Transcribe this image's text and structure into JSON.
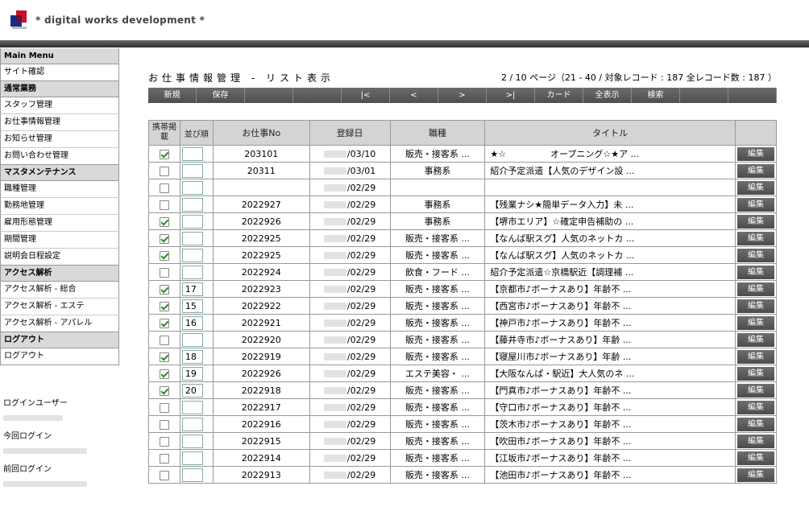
{
  "header": {
    "brand": "* digital works development *"
  },
  "sidebar": {
    "sections": [
      {
        "head": "Main Menu",
        "items": [
          "サイト確認"
        ]
      },
      {
        "head": "通常業務",
        "items": [
          "スタッフ管理",
          "お仕事情報管理",
          "お知らせ管理",
          "お問い合わせ管理"
        ]
      },
      {
        "head": "マスタメンテナンス",
        "items": [
          "職種管理",
          "勤務地管理",
          "雇用形態管理",
          "期間管理",
          "説明会日程設定"
        ]
      },
      {
        "head": "アクセス解析",
        "items": [
          "アクセス解析 - 総合",
          "アクセス解析 - エステ",
          "アクセス解析 - アパレル"
        ]
      },
      {
        "head": "ログアウト",
        "items": [
          "ログアウト"
        ]
      }
    ],
    "login_user_label": "ログインユーザー",
    "this_login_label": "今回ログイン",
    "last_login_label": "前回ログイン"
  },
  "main": {
    "title": "お仕事情報管理 - リスト表示",
    "page_info": "2 / 10 ページ（21 - 40 / 対象レコード : 187 全レコード数 : 187 ）",
    "toolbar": [
      "新規",
      "保存",
      "",
      "",
      "|<",
      "<",
      ">",
      ">|",
      "カード",
      "全表示",
      "検索",
      "",
      ""
    ],
    "columns": [
      "携帯掲載",
      "並び順",
      "お仕事No",
      "登録日",
      "職種",
      "タイトル",
      ""
    ],
    "edit_label": "編集",
    "rows": [
      {
        "checked": true,
        "order": "",
        "no": "203101",
        "date": "/03/10",
        "job": "販売・接客系 ...",
        "title": "★☆　　　　　オープニング☆★ア ..."
      },
      {
        "checked": false,
        "order": "",
        "no": "20311",
        "date": "/03/01",
        "job": "事務系",
        "title": "紹介予定派遣【人気のデザイン設 ..."
      },
      {
        "checked": false,
        "order": "",
        "no": "",
        "date": "/02/29",
        "job": "",
        "title": ""
      },
      {
        "checked": false,
        "order": "",
        "no": "2022927",
        "date": "/02/29",
        "job": "事務系",
        "title": "【残業ナシ★簡単データ入力】未 ..."
      },
      {
        "checked": true,
        "order": "",
        "no": "2022926",
        "date": "/02/29",
        "job": "事務系",
        "title": "【堺市エリア】☆確定申告補助の ..."
      },
      {
        "checked": true,
        "order": "",
        "no": "2022925",
        "date": "/02/29",
        "job": "販売・接客系 ...",
        "title": "【なんば駅スグ】人気のネットカ ..."
      },
      {
        "checked": true,
        "order": "",
        "no": "2022925",
        "date": "/02/29",
        "job": "販売・接客系 ...",
        "title": "【なんば駅スグ】人気のネットカ ..."
      },
      {
        "checked": false,
        "order": "",
        "no": "2022924",
        "date": "/02/29",
        "job": "飲食・フード ...",
        "title": "紹介予定派遣☆京橋駅近【調理補 ..."
      },
      {
        "checked": true,
        "order": "17",
        "no": "2022923",
        "date": "/02/29",
        "job": "販売・接客系 ...",
        "title": "【京都市♪ボーナスあり】年齢不 ..."
      },
      {
        "checked": true,
        "order": "15",
        "no": "2022922",
        "date": "/02/29",
        "job": "販売・接客系 ...",
        "title": "【西宮市♪ボーナスあり】年齢不 ..."
      },
      {
        "checked": true,
        "order": "16",
        "no": "2022921",
        "date": "/02/29",
        "job": "販売・接客系 ...",
        "title": "【神戸市♪ボーナスあり】年齢不 ..."
      },
      {
        "checked": false,
        "order": "",
        "no": "2022920",
        "date": "/02/29",
        "job": "販売・接客系 ...",
        "title": "【藤井寺市♪ボーナスあり】年齢 ..."
      },
      {
        "checked": true,
        "order": "18",
        "no": "2022919",
        "date": "/02/29",
        "job": "販売・接客系 ...",
        "title": "【寝屋川市♪ボーナスあり】年齢 ..."
      },
      {
        "checked": true,
        "order": "19",
        "no": "2022926",
        "date": "/02/29",
        "job": "エステ美容・ ...",
        "title": "【大阪なんば・駅近】大人気のネ ..."
      },
      {
        "checked": true,
        "order": "20",
        "no": "2022918",
        "date": "/02/29",
        "job": "販売・接客系 ...",
        "title": "【門真市♪ボーナスあり】年齢不 ..."
      },
      {
        "checked": false,
        "order": "",
        "no": "2022917",
        "date": "/02/29",
        "job": "販売・接客系 ...",
        "title": "【守口市♪ボーナスあり】年齢不 ..."
      },
      {
        "checked": false,
        "order": "",
        "no": "2022916",
        "date": "/02/29",
        "job": "販売・接客系 ...",
        "title": "【茨木市♪ボーナスあり】年齢不 ..."
      },
      {
        "checked": false,
        "order": "",
        "no": "2022915",
        "date": "/02/29",
        "job": "販売・接客系 ...",
        "title": "【吹田市♪ボーナスあり】年齢不 ..."
      },
      {
        "checked": false,
        "order": "",
        "no": "2022914",
        "date": "/02/29",
        "job": "販売・接客系 ...",
        "title": "【江坂市♪ボーナスあり】年齢不 ..."
      },
      {
        "checked": false,
        "order": "",
        "no": "2022913",
        "date": "/02/29",
        "job": "販売・接客系 ...",
        "title": "【池田市♪ボーナスあり】年齢不 ..."
      }
    ]
  }
}
